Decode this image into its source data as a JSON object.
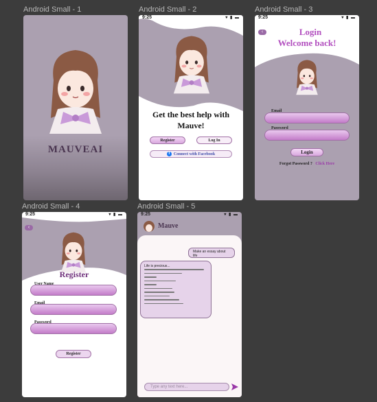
{
  "frames": [
    {
      "label": "Android Small - 1",
      "brand": "MAUVEAI"
    },
    {
      "label": "Android Small - 2",
      "time": "9:25",
      "headline": "Get the best help with Mauve!",
      "register": "Register",
      "login": "Log In",
      "facebook": "Connect with Facebook"
    },
    {
      "label": "Android Small - 3",
      "time": "9:25",
      "title": "Login",
      "welcome": "Welcome back!",
      "email": "Email",
      "password": "Password",
      "login_btn": "Login",
      "forgot": "Forgot Password ?",
      "click_here": "Click Here"
    },
    {
      "label": "Android Small - 4",
      "time": "9:25",
      "title": "Register",
      "username": "User Name",
      "email": "Email",
      "password": "Password",
      "register_btn": "Register"
    },
    {
      "label": "Android Small - 5",
      "time": "9:25",
      "header": "Mauve",
      "user_msg": "Make an essay about life",
      "bot_msg": "Life is precious...",
      "input_placeholder": "Type any text here..."
    }
  ],
  "colors": {
    "mauve": "#ab9fb0",
    "accent": "#9a3aa8",
    "pink": "#e8c4ec"
  }
}
